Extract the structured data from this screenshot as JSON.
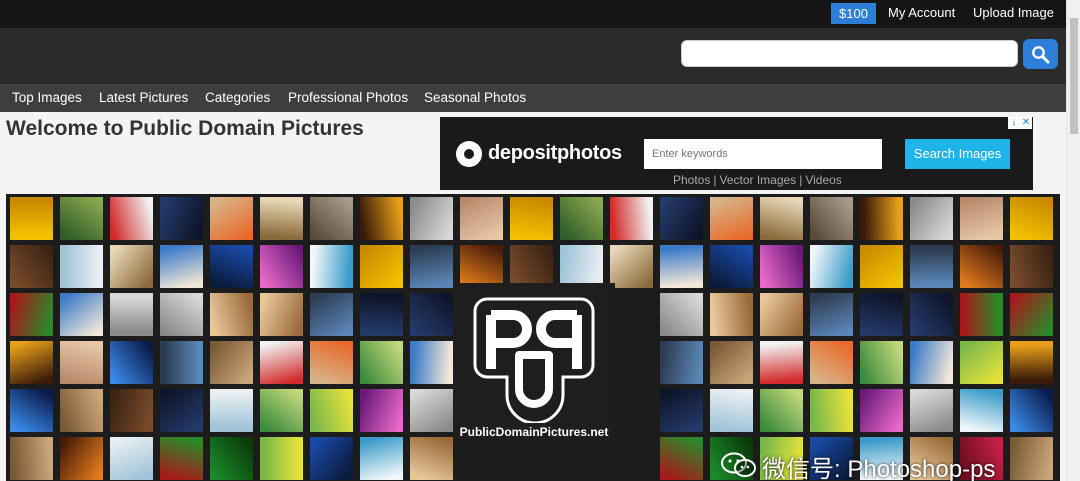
{
  "topbar": {
    "credit_label": "$100",
    "account_link": "My Account",
    "upload_link": "Upload Image"
  },
  "search": {
    "value": "",
    "button_icon": "search-icon"
  },
  "nav": {
    "items": [
      "Top Images",
      "Latest Pictures",
      "Categories",
      "Professional Photos",
      "Seasonal Photos"
    ]
  },
  "welcome_title": "Welcome to Public Domain Pictures",
  "ad": {
    "brand": "depositphotos",
    "search_placeholder": "Enter keywords",
    "search_button": "Search Images",
    "links": [
      "Photos",
      "Vector Images",
      "Videos"
    ]
  },
  "mosaic": {
    "logo_caption": "PublicDomainPictures.net"
  },
  "watermark": "微信号: Photoshop-ps",
  "colors": {
    "accent": "#2c7ed6",
    "ad_button": "#1fb4e8"
  }
}
